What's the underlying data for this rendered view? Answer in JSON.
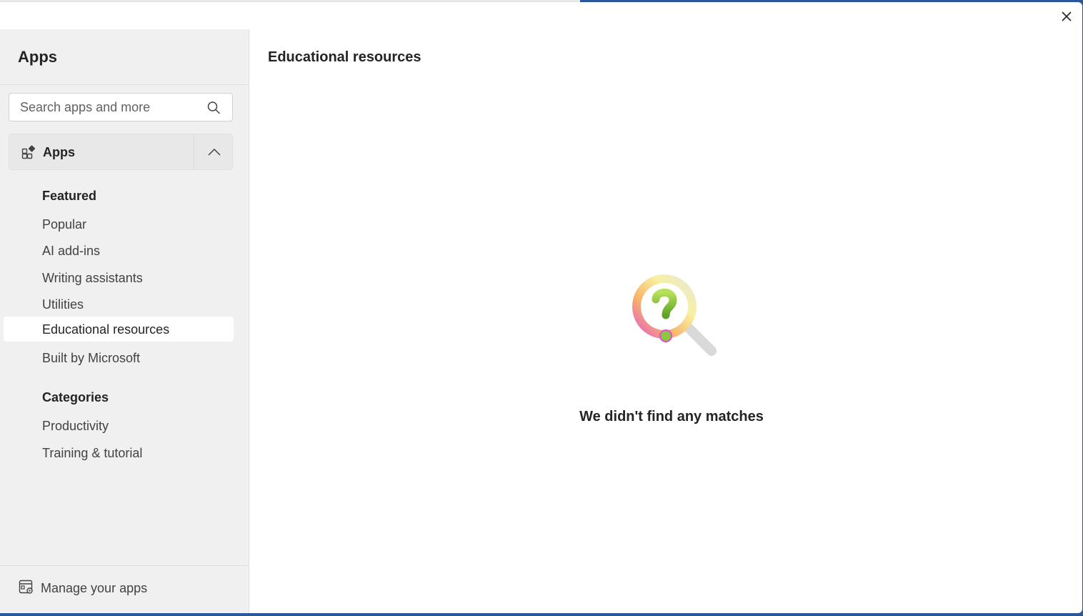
{
  "dialog": {
    "close_label": "Close"
  },
  "sidebar": {
    "title": "Apps",
    "search": {
      "placeholder": "Search apps and more",
      "value": ""
    },
    "group": {
      "label": "Apps",
      "expanded": true
    },
    "featured_heading": "Featured",
    "featured_items": [
      {
        "label": "Popular"
      },
      {
        "label": "AI add-ins"
      },
      {
        "label": "Writing assistants"
      },
      {
        "label": "Utilities"
      },
      {
        "label": "Educational resources",
        "selected": true
      },
      {
        "label": "Built by Microsoft"
      }
    ],
    "categories_heading": "Categories",
    "category_items": [
      {
        "label": "Productivity"
      },
      {
        "label": "Training & tutorial"
      }
    ],
    "manage_label": "Manage your apps"
  },
  "main": {
    "title": "Educational resources",
    "empty_message": "We didn't find any matches",
    "illustration_icon": "magnifier-question-icon"
  },
  "colors": {
    "sidebar_bg": "#f0f0f0",
    "selected_bg": "#ffffff",
    "accent_green": "#8dc63f",
    "text_primary": "#242424"
  }
}
